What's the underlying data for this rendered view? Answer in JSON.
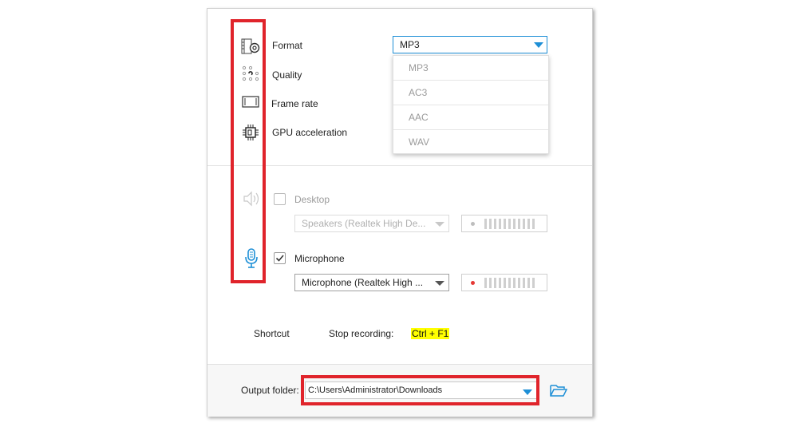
{
  "settings": {
    "format": {
      "label": "Format",
      "icon": "video-settings-icon"
    },
    "quality": {
      "label": "Quality",
      "icon": "quality-dots-icon"
    },
    "frame_rate": {
      "label": "Frame rate",
      "icon": "film-frame-icon"
    },
    "gpu": {
      "label": "GPU acceleration",
      "icon": "chip-icon"
    }
  },
  "format_select": {
    "selected": "MP3",
    "options": [
      "MP3",
      "AC3",
      "AAC",
      "WAV"
    ],
    "accent_color": "#1e8fd6"
  },
  "audio": {
    "desktop": {
      "label": "Desktop",
      "checked": false,
      "device": "Speakers (Realtek High De...",
      "icon": "speaker-icon",
      "level_dot_color": "#bdbdbd"
    },
    "microphone": {
      "label": "Microphone",
      "checked": true,
      "device": "Microphone (Realtek High ...",
      "icon": "microphone-icon",
      "level_dot_color": "#e53935",
      "icon_color": "#1e8fd6"
    }
  },
  "shortcut": {
    "label": "Shortcut",
    "action": "Stop recording:",
    "keys": "Ctrl + F1"
  },
  "output": {
    "label": "Output folder:",
    "path": "C:\\Users\\Administrator\\Downloads",
    "folder_icon": "folder-open-icon"
  },
  "highlight_color": "#e0242b"
}
